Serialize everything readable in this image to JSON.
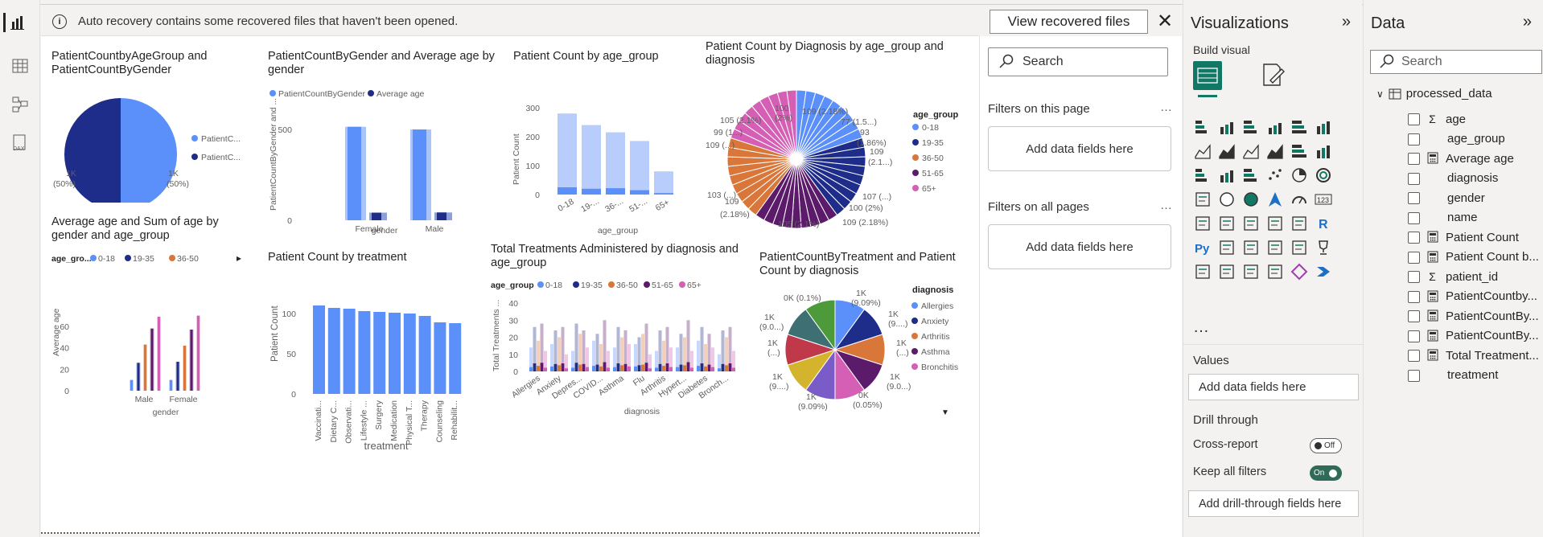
{
  "banner": {
    "message": "Auto recovery contains some recovered files that haven't been opened.",
    "button": "View recovered files"
  },
  "visuals": {
    "v1": {
      "title": "PatientCountbyAgeGroup and PatientCountByGender",
      "legend": [
        "PatientC...",
        "PatientC..."
      ],
      "labels": [
        "1K\n(50%)",
        "1K\n(50%)"
      ]
    },
    "v2": {
      "title": "PatientCountByGender and Average age by gender",
      "legend": [
        "PatientCountByGender",
        "Average age"
      ],
      "yaxis": "PatientCountByGender and ...",
      "xaxis": "gender"
    },
    "v3": {
      "title": "Patient Count by age_group",
      "yaxis": "Patient Count",
      "xaxis": "age_group"
    },
    "v4": {
      "title": "Patient Count by Diagnosis by age_group and diagnosis",
      "legend_title": "age_group"
    },
    "v5": {
      "title": "Average age and Sum of age by gender and age_group",
      "legend_title": "age_gro...",
      "yaxis": "Average age",
      "xaxis": "gender"
    },
    "v6": {
      "title": "Patient Count by treatment",
      "yaxis": "Patient Count",
      "xaxis": "treatment"
    },
    "v7": {
      "title": "Total Treatments Administered by diagnosis and age_group",
      "legend_title": "age_group",
      "yaxis": "Total Treatments ...",
      "xaxis": "diagnosis"
    },
    "v8": {
      "title": "PatientCountByTreatment and Patient Count by diagnosis",
      "legend_title": "diagnosis"
    }
  },
  "chart_data": [
    {
      "type": "pie",
      "title": "PatientCountbyAgeGroup and PatientCountByGender",
      "values": [
        1000,
        1000
      ],
      "labels": [
        "1K (50%)",
        "1K (50%)"
      ],
      "legend": [
        "PatientC...",
        "PatientC..."
      ]
    },
    {
      "type": "bar",
      "title": "PatientCountByGender and Average age by gender",
      "categories": [
        "Female",
        "Male"
      ],
      "series": [
        {
          "name": "PatientCountByGender",
          "values": [
            515,
            500
          ]
        },
        {
          "name": "Average age",
          "values": [
            42,
            43
          ]
        }
      ],
      "ylim": [
        0,
        620
      ],
      "yticks": [
        0,
        500
      ]
    },
    {
      "type": "bar",
      "title": "Patient Count by age_group",
      "categories": [
        "0-18",
        "19-...",
        "36-...",
        "51-...",
        "65+"
      ],
      "series": [
        {
          "name": "total",
          "values": [
            280,
            240,
            215,
            185,
            80
          ]
        },
        {
          "name": "sub",
          "values": [
            25,
            20,
            22,
            15,
            5
          ]
        }
      ],
      "ylim": [
        0,
        300
      ],
      "yticks": [
        0,
        100,
        200,
        300
      ]
    },
    {
      "type": "pie",
      "title": "Patient Count by Diagnosis by age_group and diagnosis",
      "legend": [
        "0-18",
        "19-35",
        "36-50",
        "51-65",
        "65+"
      ],
      "labels": [
        "109 (2.18%)",
        "77 (1.5...)",
        "93 (1.86%)",
        "109 (2.1...)",
        "107 (...)",
        "100 (2%)",
        "109 (2.18%)",
        "105 (2.1%)",
        "109 (2.18%)",
        "103 (...)",
        "109 (...)",
        "99 (1...)",
        "105 (2.1%)",
        "100 (2%)"
      ]
    },
    {
      "type": "bar",
      "title": "Average age and Sum of age by gender and age_group",
      "categories": [
        "Male",
        "Female"
      ],
      "legend": [
        "0-18",
        "19-35",
        "36-50"
      ],
      "series": [
        {
          "name": "0-18",
          "values": [
            10,
            10
          ]
        },
        {
          "name": "19-35",
          "values": [
            26,
            27
          ]
        },
        {
          "name": "36-50",
          "values": [
            43,
            42
          ]
        },
        {
          "name": "51-65",
          "values": [
            58,
            57
          ]
        },
        {
          "name": "65+",
          "values": [
            69,
            70
          ]
        }
      ],
      "ylim": [
        0,
        75
      ],
      "yticks": [
        0,
        20,
        40,
        60
      ]
    },
    {
      "type": "bar",
      "title": "Patient Count by treatment",
      "categories": [
        "Vaccinati...",
        "Dietary C...",
        "Observati...",
        "Lifestyle ...",
        "Surgery",
        "Medication",
        "Physical T...",
        "Therapy",
        "Counseling",
        "Rehabilit..."
      ],
      "values": [
        110,
        107,
        106,
        103,
        102,
        101,
        100,
        97,
        89,
        88
      ],
      "ylim": [
        0,
        120
      ],
      "yticks": [
        0,
        50,
        100
      ]
    },
    {
      "type": "bar",
      "title": "Total Treatments Administered by diagnosis and age_group",
      "categories": [
        "Allergies",
        "Anxiety",
        "Depres...",
        "COVID...",
        "Asthma",
        "Flu",
        "Arthritis",
        "Hypert...",
        "Diabetes",
        "Bronch..."
      ],
      "legend": [
        "0-18",
        "19-35",
        "36-50",
        "51-65",
        "65+"
      ],
      "ylim": [
        0,
        40
      ],
      "yticks": [
        0,
        10,
        20,
        30,
        40
      ]
    },
    {
      "type": "pie",
      "title": "PatientCountByTreatment and Patient Count by diagnosis",
      "legend": [
        "Allergies",
        "Anxiety",
        "Arthritis",
        "Asthma",
        "Bronchitis"
      ],
      "labels": [
        "1K (9.09%)",
        "1K (9....)",
        "1K (...)",
        "1K (9.0...)",
        "0K (0.05%)",
        "1K (9.09%)",
        "1K (...)",
        "1K (...)",
        "1K (9.0...)",
        "0K (0.1%)"
      ]
    }
  ],
  "filters": {
    "search": "Search",
    "on_page": "Filters on this page",
    "on_all": "Filters on all pages",
    "add": "Add data fields here"
  },
  "viz": {
    "title": "Visualizations",
    "build": "Build visual",
    "values": "Values",
    "add": "Add data fields here",
    "drill": "Drill through",
    "cross": "Cross-report",
    "cross_state": "Off",
    "keep": "Keep all filters",
    "keep_state": "On",
    "add_drill": "Add drill-through fields here"
  },
  "data": {
    "title": "Data",
    "search": "Search",
    "table": "processed_data",
    "fields": [
      {
        "name": "age",
        "type": "Σ"
      },
      {
        "name": "age_group",
        "type": ""
      },
      {
        "name": "Average age",
        "type": "calc"
      },
      {
        "name": "diagnosis",
        "type": ""
      },
      {
        "name": "gender",
        "type": ""
      },
      {
        "name": "name",
        "type": ""
      },
      {
        "name": "Patient Count",
        "type": "calc"
      },
      {
        "name": "Patient Count b...",
        "type": "calc"
      },
      {
        "name": "patient_id",
        "type": "Σ"
      },
      {
        "name": "PatientCountby...",
        "type": "calc"
      },
      {
        "name": "PatientCountBy...",
        "type": "calc"
      },
      {
        "name": "PatientCountBy...",
        "type": "calc"
      },
      {
        "name": "Total Treatment...",
        "type": "calc"
      },
      {
        "name": "treatment",
        "type": ""
      }
    ]
  },
  "colors": {
    "accent": "#118dff",
    "blue": "#5b8ff9",
    "navy": "#1f2d8a",
    "orange": "#d9773a",
    "purple": "#5c1a6b",
    "pink": "#d45fb5",
    "selected": "#117865",
    "toggleon": "#2f6b59"
  }
}
